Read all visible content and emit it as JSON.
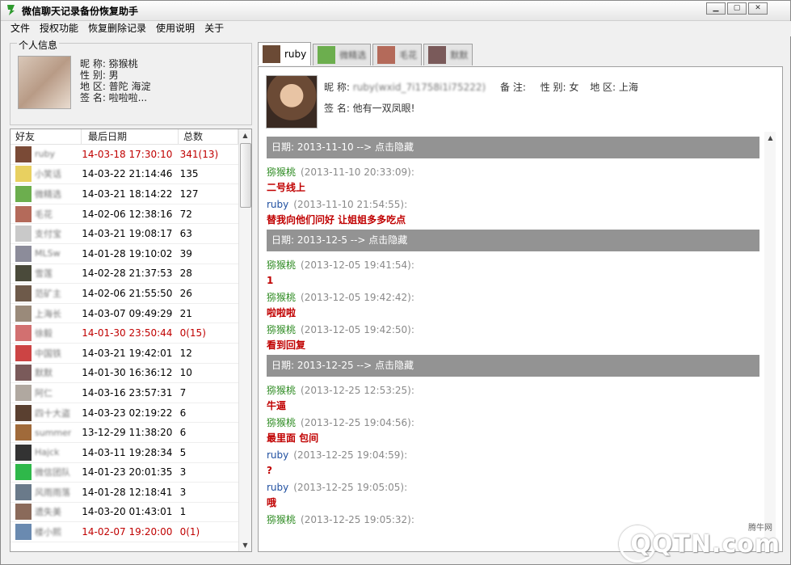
{
  "window": {
    "title": "微信聊天记录备份恢复助手"
  },
  "menu": [
    "文件",
    "授权功能",
    "恢复删除记录",
    "使用说明",
    "关于"
  ],
  "profile": {
    "legend": "个人信息",
    "nickname": "昵 称: 猕猴桃",
    "gender": "性 别: 男",
    "region": "地 区: 普陀 海淀",
    "signature": "签 名: 啦啦啦..."
  },
  "friends": {
    "headers": [
      "好友",
      "最后日期",
      "总数"
    ],
    "rows": [
      {
        "name": "ruby",
        "date": "14-03-18 17:30:10",
        "count": "341(13)",
        "red": true,
        "color": "#7a4a36"
      },
      {
        "name": "小笑话",
        "date": "14-03-22 21:14:46",
        "count": "135",
        "red": false,
        "color": "#e8d060"
      },
      {
        "name": "微精选",
        "date": "14-03-21 18:14:22",
        "count": "127",
        "red": false,
        "color": "#6cae4e"
      },
      {
        "name": "毛花",
        "date": "14-02-06 12:38:16",
        "count": "72",
        "red": false,
        "color": "#b46a5a"
      },
      {
        "name": "支付宝",
        "date": "14-03-21 19:08:17",
        "count": "63",
        "red": false,
        "color": "#c9c9c9"
      },
      {
        "name": "MLSw",
        "date": "14-01-28 19:10:02",
        "count": "39",
        "red": false,
        "color": "#8c8c9a"
      },
      {
        "name": "雪莲",
        "date": "14-02-28 21:37:53",
        "count": "28",
        "red": false,
        "color": "#4a4a3a"
      },
      {
        "name": "范矿主",
        "date": "14-02-06 21:55:50",
        "count": "26",
        "red": false,
        "color": "#6e5a4a"
      },
      {
        "name": "上海长",
        "date": "14-03-07 09:49:29",
        "count": "21",
        "red": false,
        "color": "#9a8a7a"
      },
      {
        "name": "徐毅",
        "date": "14-01-30 23:50:44",
        "count": "0(15)",
        "red": true,
        "color": "#d27070"
      },
      {
        "name": "中国铁",
        "date": "14-03-21 19:42:01",
        "count": "12",
        "red": false,
        "color": "#c44"
      },
      {
        "name": "默默",
        "date": "14-01-30 16:36:12",
        "count": "10",
        "red": false,
        "color": "#7a5a5a"
      },
      {
        "name": "阿仁",
        "date": "14-03-16 23:57:31",
        "count": "7",
        "red": false,
        "color": "#b0a8a0"
      },
      {
        "name": "四十大盗",
        "date": "14-03-23 02:19:22",
        "count": "6",
        "red": false,
        "color": "#5a4030"
      },
      {
        "name": "summer",
        "date": "13-12-29 11:38:20",
        "count": "6",
        "red": false,
        "color": "#a06a3a"
      },
      {
        "name": "Hajck",
        "date": "14-03-11 19:28:34",
        "count": "5",
        "red": false,
        "color": "#333"
      },
      {
        "name": "微信团队",
        "date": "14-01-23 20:01:35",
        "count": "3",
        "red": false,
        "color": "#2fb84a"
      },
      {
        "name": "风雨雨落",
        "date": "14-01-28 12:18:41",
        "count": "3",
        "red": false,
        "color": "#6a7a8a"
      },
      {
        "name": "遗失美",
        "date": "14-03-20 01:43:01",
        "count": "1",
        "red": false,
        "color": "#8a6a5a"
      },
      {
        "name": "楼小熙",
        "date": "14-02-07 19:20:00",
        "count": "0(1)",
        "red": true,
        "color": "#6a8ab0"
      }
    ]
  },
  "tabs": [
    {
      "label": "ruby",
      "active": true,
      "color": "#6b4a35",
      "blur": false
    },
    {
      "label": "微精选",
      "active": false,
      "color": "#6cae4e",
      "blur": true
    },
    {
      "label": "毛花",
      "active": false,
      "color": "#b46a5a",
      "blur": true
    },
    {
      "label": "默默",
      "active": false,
      "color": "#7a5a5a",
      "blur": true
    }
  ],
  "contact": {
    "nickname_label": "昵 称: ",
    "nickname_value": "ruby(wxid_7i1758i1i75222)",
    "remark": "备 注:",
    "gender": "性 别: 女",
    "region": "地 区: 上海",
    "signature": "签 名: 他有一双凤眼!"
  },
  "chat": [
    {
      "type": "date",
      "text": "日期: 2013-11-10  --> 点击隐藏"
    },
    {
      "type": "msg",
      "sender": "猕猴桃",
      "me": true,
      "time": "(2013-11-10 20:33:09):",
      "text": "二号线上"
    },
    {
      "type": "msg",
      "sender": "ruby",
      "me": false,
      "time": "(2013-11-10 21:54:55):",
      "text": "替我向他们问好 让姐姐多多吃点"
    },
    {
      "type": "date",
      "text": "日期: 2013-12-5  --> 点击隐藏"
    },
    {
      "type": "msg",
      "sender": "猕猴桃",
      "me": true,
      "time": "(2013-12-05 19:41:54):",
      "text": "1"
    },
    {
      "type": "msg",
      "sender": "猕猴桃",
      "me": true,
      "time": "(2013-12-05 19:42:42):",
      "text": "啦啦啦"
    },
    {
      "type": "msg",
      "sender": "猕猴桃",
      "me": true,
      "time": "(2013-12-05 19:42:50):",
      "text": "看到回复"
    },
    {
      "type": "date",
      "text": "日期: 2013-12-25  --> 点击隐藏"
    },
    {
      "type": "msg",
      "sender": "猕猴桃",
      "me": true,
      "time": "(2013-12-25 12:53:25):",
      "text": "牛逼"
    },
    {
      "type": "msg",
      "sender": "猕猴桃",
      "me": true,
      "time": "(2013-12-25 19:04:56):",
      "text": "最里面 包间"
    },
    {
      "type": "msg",
      "sender": "ruby",
      "me": false,
      "time": "(2013-12-25 19:04:59):",
      "text": "?"
    },
    {
      "type": "msg",
      "sender": "ruby",
      "me": false,
      "time": "(2013-12-25 19:05:05):",
      "text": "哦"
    },
    {
      "type": "msg",
      "sender": "猕猴桃",
      "me": true,
      "time": "(2013-12-25 19:05:32):",
      "text": ""
    }
  ],
  "watermark": {
    "sub": "腾牛网",
    "text": "QQTN.com"
  }
}
